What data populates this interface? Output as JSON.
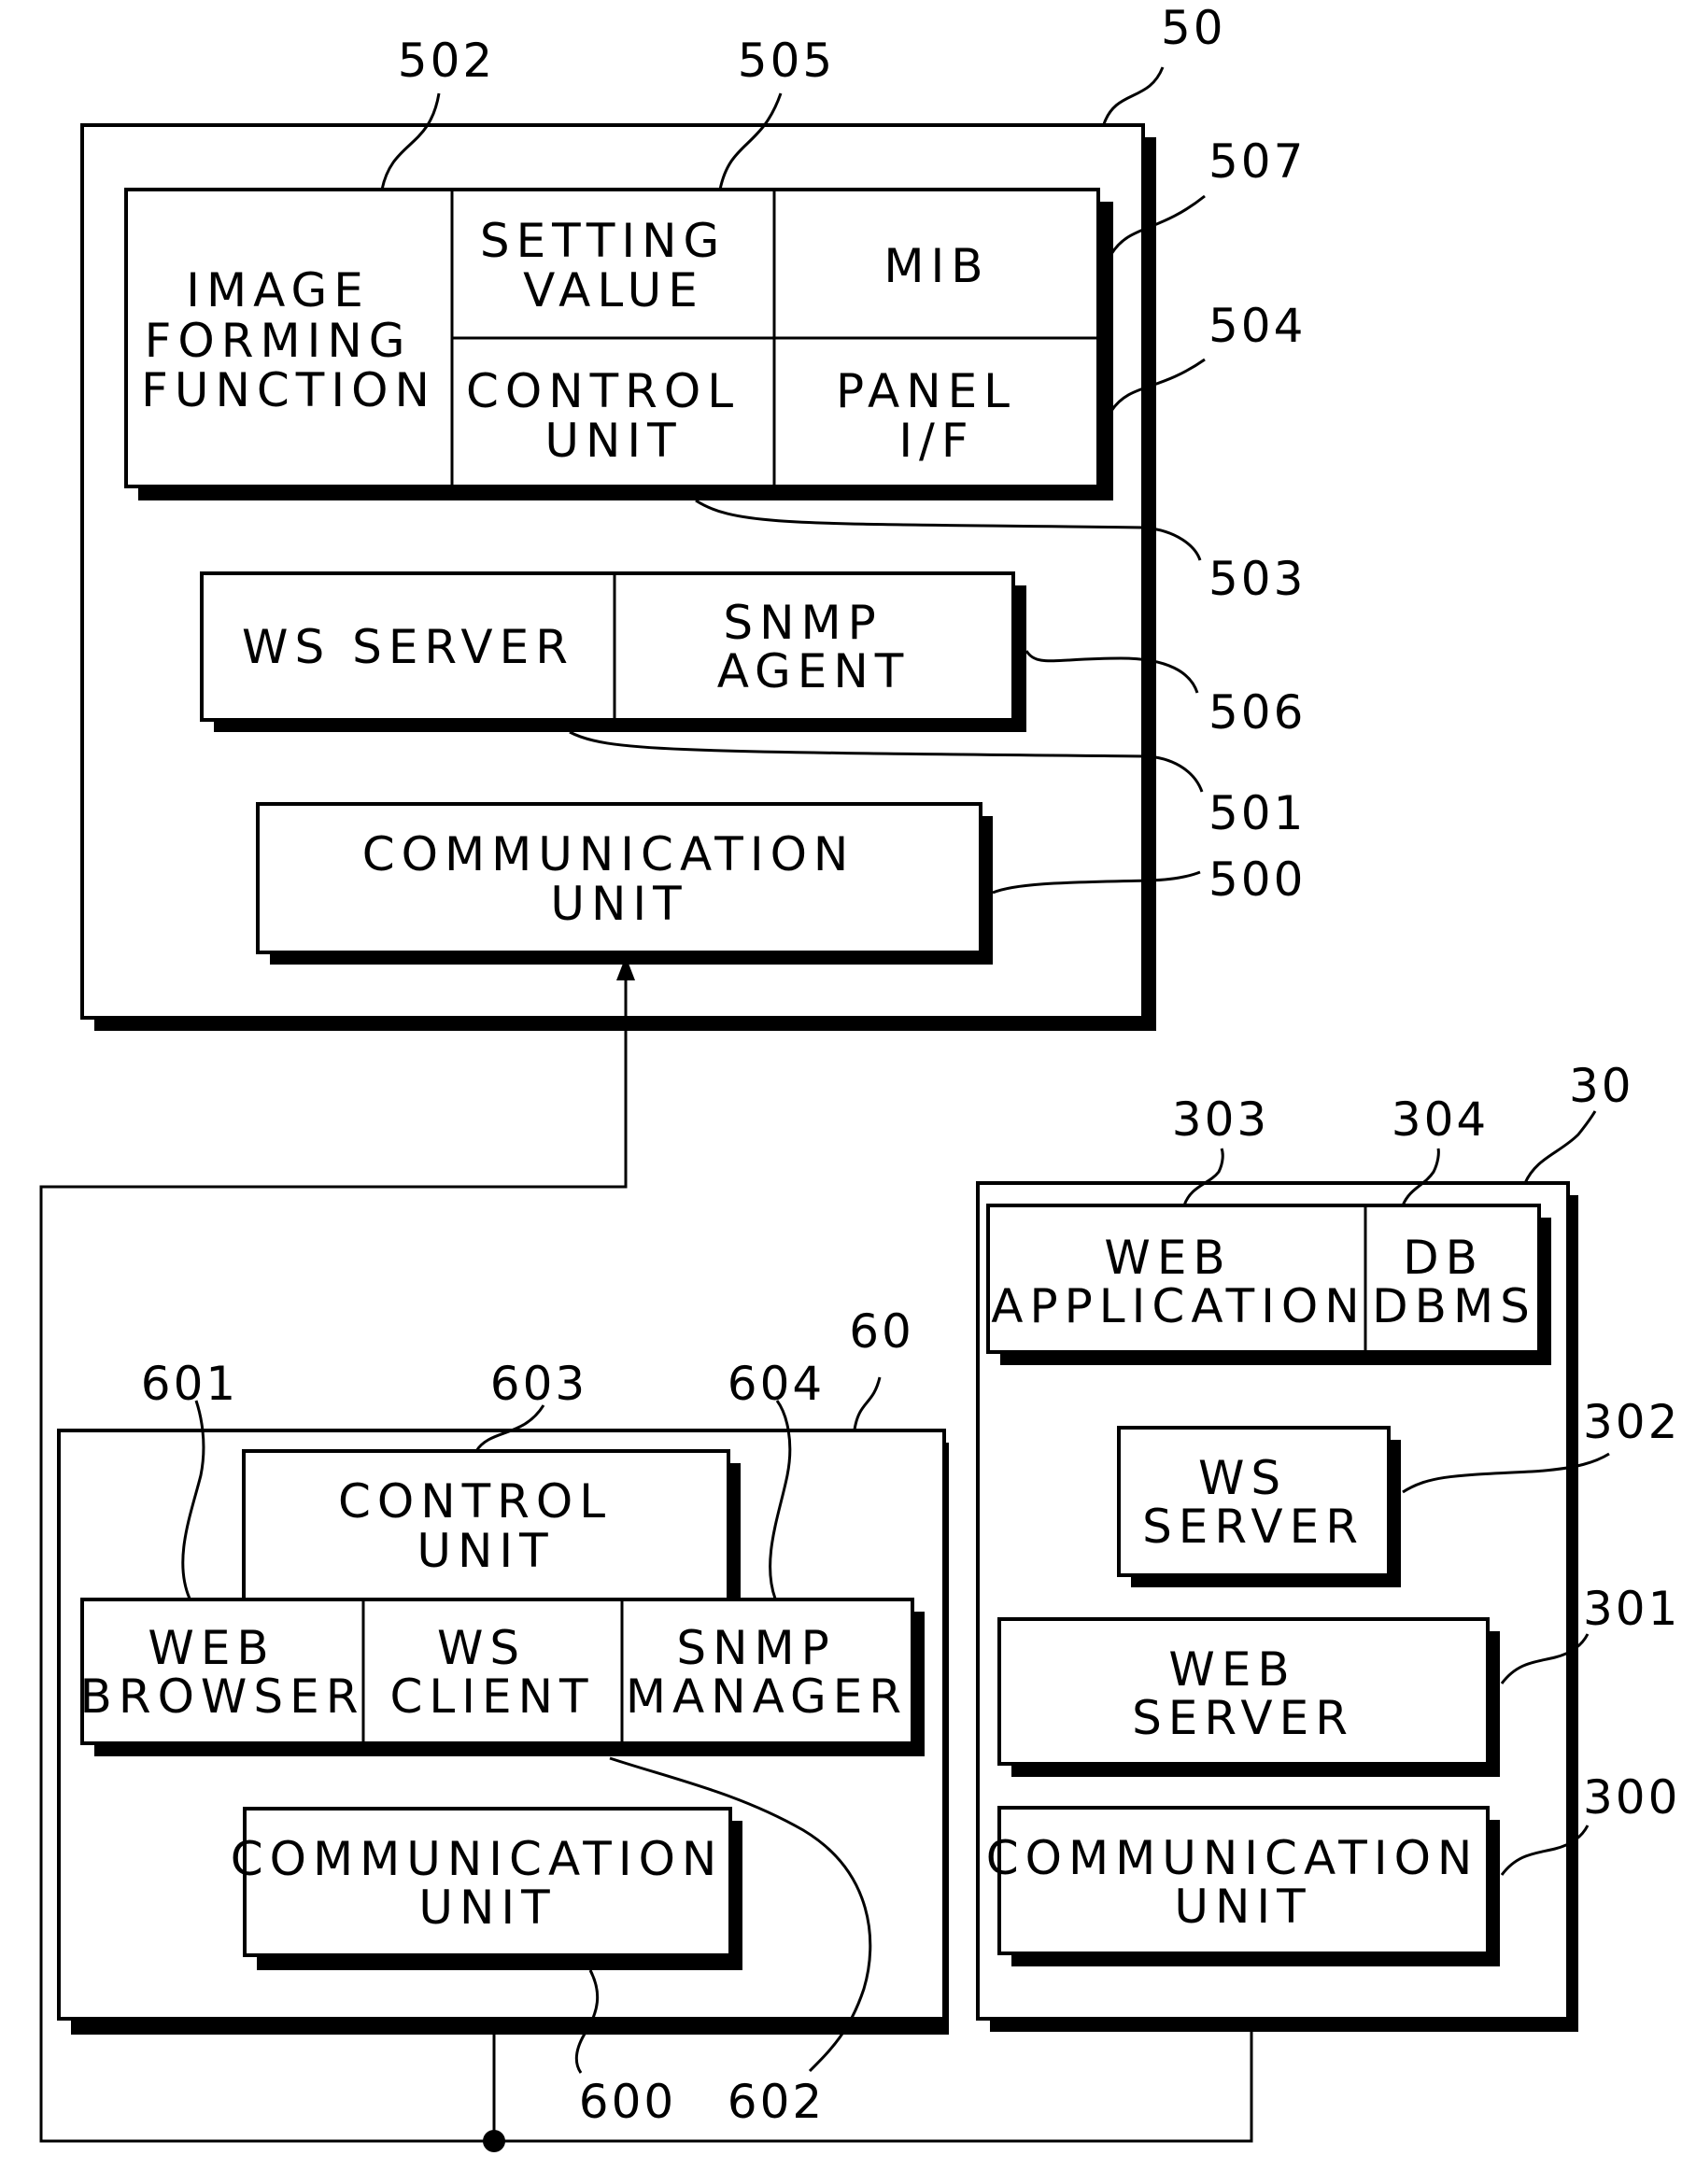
{
  "figure": {
    "device_50": {
      "ref": "50",
      "image_forming_function": {
        "ref": "502",
        "lines": [
          "IMAGE",
          "FORMING",
          "FUNCTION"
        ]
      },
      "setting_value": {
        "ref": "505",
        "lines": [
          "SETTING",
          "VALUE"
        ]
      },
      "mib": {
        "ref": "507",
        "lines": [
          "MIB"
        ]
      },
      "control_unit": {
        "ref": "503",
        "lines": [
          "CONTROL",
          "UNIT"
        ]
      },
      "panel_if": {
        "ref": "504",
        "lines": [
          "PANEL",
          "I/F"
        ]
      },
      "ws_server": {
        "ref": "501",
        "lines": [
          "WS SERVER"
        ]
      },
      "snmp_agent": {
        "ref": "506",
        "lines": [
          "SNMP",
          "AGENT"
        ]
      },
      "communication_unit": {
        "ref": "500",
        "lines": [
          "COMMUNICATION",
          "UNIT"
        ]
      }
    },
    "device_60": {
      "ref": "60",
      "control_unit": {
        "ref": "603",
        "lines": [
          "CONTROL",
          "UNIT"
        ]
      },
      "web_browser": {
        "ref": "601",
        "lines": [
          "WEB",
          "BROWSER"
        ]
      },
      "ws_client": {
        "ref": "602",
        "lines": [
          "WS",
          "CLIENT"
        ]
      },
      "snmp_manager": {
        "ref": "604",
        "lines": [
          "SNMP",
          "MANAGER"
        ]
      },
      "communication_unit": {
        "ref": "600",
        "lines": [
          "COMMUNICATION",
          "UNIT"
        ]
      }
    },
    "device_30": {
      "ref": "30",
      "web_application": {
        "ref": "303",
        "lines": [
          "WEB",
          "APPLICATION"
        ]
      },
      "db_dbms": {
        "ref": "304",
        "lines": [
          "DB",
          "DBMS"
        ]
      },
      "ws_server": {
        "ref": "302",
        "lines": [
          "WS",
          "SERVER"
        ]
      },
      "web_server": {
        "ref": "301",
        "lines": [
          "WEB",
          "SERVER"
        ]
      },
      "communication_unit": {
        "ref": "300",
        "lines": [
          "COMMUNICATION",
          "UNIT"
        ]
      }
    }
  }
}
